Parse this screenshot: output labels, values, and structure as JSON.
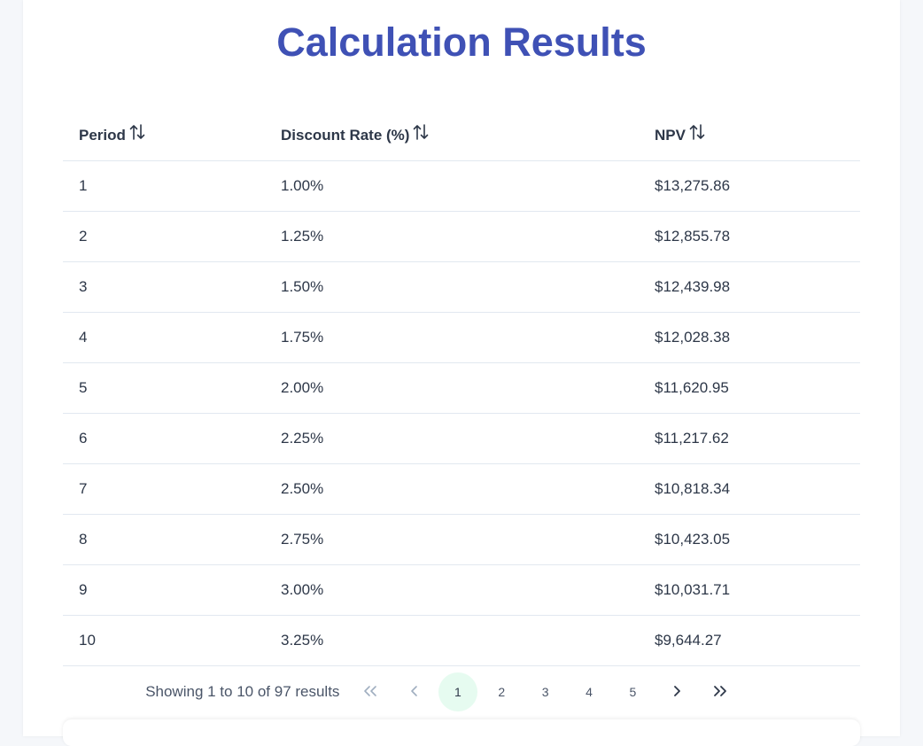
{
  "title": "Calculation Results",
  "table": {
    "columns": [
      {
        "label": "Period",
        "sort_icon": "sort-up-down-icon"
      },
      {
        "label": "Discount Rate (%)",
        "sort_icon": "sort-up-down-icon"
      },
      {
        "label": "NPV",
        "sort_icon": "sort-up-down-icon"
      }
    ],
    "rows": [
      {
        "period": "1",
        "rate": "1.00%",
        "npv": "$13,275.86"
      },
      {
        "period": "2",
        "rate": "1.25%",
        "npv": "$12,855.78"
      },
      {
        "period": "3",
        "rate": "1.50%",
        "npv": "$12,439.98"
      },
      {
        "period": "4",
        "rate": "1.75%",
        "npv": "$12,028.38"
      },
      {
        "period": "5",
        "rate": "2.00%",
        "npv": "$11,620.95"
      },
      {
        "period": "6",
        "rate": "2.25%",
        "npv": "$11,217.62"
      },
      {
        "period": "7",
        "rate": "2.50%",
        "npv": "$10,818.34"
      },
      {
        "period": "8",
        "rate": "2.75%",
        "npv": "$10,423.05"
      },
      {
        "period": "9",
        "rate": "3.00%",
        "npv": "$10,031.71"
      },
      {
        "period": "10",
        "rate": "3.25%",
        "npv": "$9,644.27"
      }
    ]
  },
  "pagination": {
    "info": "Showing 1 to 10 of 97 results",
    "pages": [
      "1",
      "2",
      "3",
      "4",
      "5"
    ],
    "current_page": "1",
    "first_icon": "chevrons-left-icon",
    "prev_icon": "chevron-left-icon",
    "next_icon": "chevron-right-icon",
    "last_icon": "chevrons-right-icon"
  },
  "colors": {
    "title": "#3f51b5",
    "active_page_bg": "#e6fbf0",
    "border": "#e2e8f0",
    "page_bg": "#f5f7fa"
  }
}
